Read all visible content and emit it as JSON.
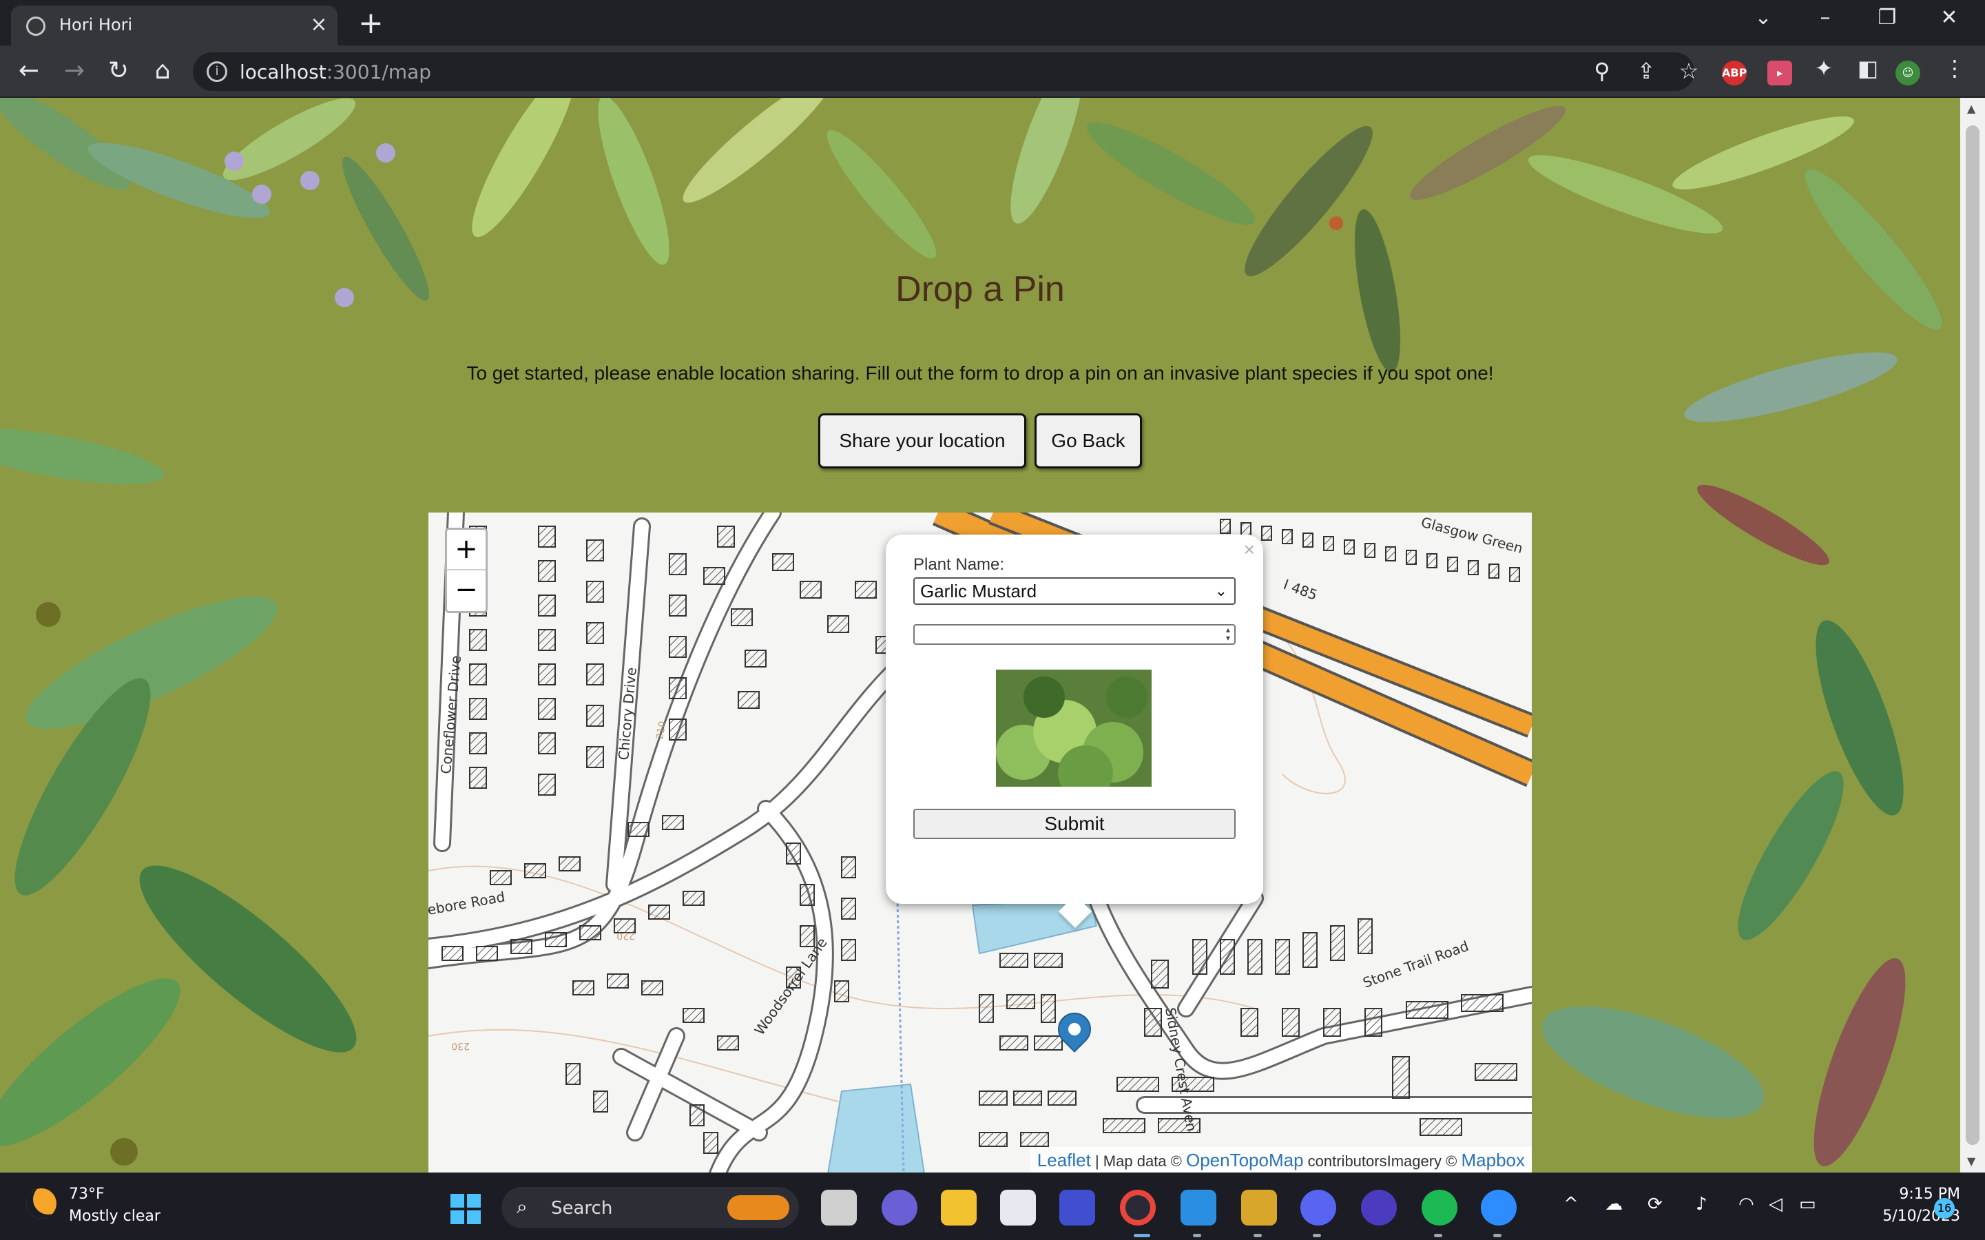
{
  "browser": {
    "tab_title": "Hori Hori",
    "tab_close": "×",
    "new_tab": "+",
    "url_host": "localhost",
    "url_path": ":3001/map",
    "window_controls": [
      "⌄",
      "–",
      "❐",
      "✕"
    ],
    "nav": {
      "back": "←",
      "forward": "→",
      "reload": "↻",
      "home": "⌂"
    },
    "extensions": [
      "ABP"
    ]
  },
  "page": {
    "title": "Drop a Pin",
    "intro": "To get started, please enable location sharing. Fill out the form to drop a pin on an invasive plant species if you spot one!",
    "share_button": "Share your location",
    "back_button": "Go Back"
  },
  "map": {
    "zoom_in": "+",
    "zoom_out": "−",
    "street_labels": [
      "Coneflower Drive",
      "Chicory Drive",
      "Glasgow Green",
      "I 485",
      "Woodsorrel Lane",
      "Stone Trail Road",
      "Sidney Crest Aven",
      "ebore Road",
      "210",
      "220",
      "230"
    ],
    "attribution": {
      "leaflet": "Leaflet",
      "mid": " | Map data © ",
      "opentopomap": "OpenTopoMap",
      "tail": " contributorsImagery © ",
      "mapbox": "Mapbox"
    },
    "popup": {
      "close": "×",
      "label": "Plant Name:",
      "selected_plant": "Garlic Mustard",
      "quantity_value": "",
      "submit": "Submit"
    }
  },
  "taskbar": {
    "temperature": "73°F",
    "weather": "Mostly clear",
    "search_placeholder": "Search",
    "time": "9:15 PM",
    "date": "5/10/2023",
    "notifications": "16"
  },
  "colors": {
    "page_bg": "#8b9a43",
    "title_text": "#4a2d1c",
    "highway": "#f0a030",
    "water": "#a8d8ea",
    "marker": "#2f7fc0"
  }
}
